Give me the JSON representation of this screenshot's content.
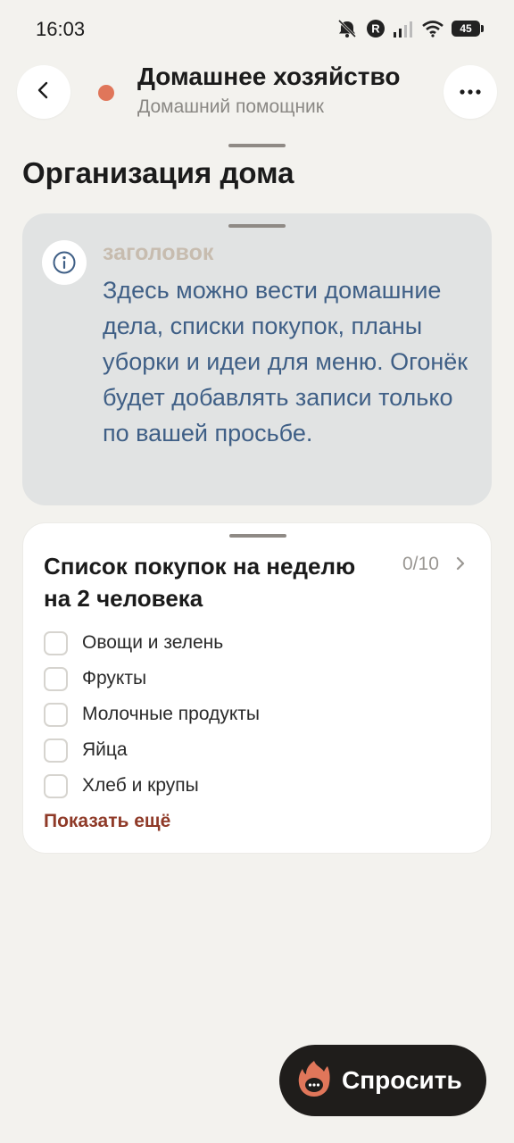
{
  "status_bar": {
    "time": "16:03",
    "battery": "45",
    "icons": [
      "mute-icon",
      "r-badge-icon",
      "signal-icon",
      "wifi-icon",
      "battery-icon"
    ]
  },
  "header": {
    "title": "Домашнее хозяйство",
    "subtitle": "Домашний помощник",
    "back_icon": "chevron-left-icon",
    "menu_icon": "more-horizontal-icon",
    "dot_color": "#e0765a"
  },
  "section": {
    "title": "Организация дома"
  },
  "info_card": {
    "label": "заголовок",
    "text": "Здесь можно вести домашние дела, списки покупок, планы уборки и идеи для меню. Огонёк будет добавлять записи только по вашей просьбе.",
    "icon": "info-icon"
  },
  "list_card": {
    "title": "Список покупок на неделю на 2 человека",
    "count": "0/10",
    "items": [
      {
        "label": "Овощи и зелень",
        "checked": false
      },
      {
        "label": "Фрукты",
        "checked": false
      },
      {
        "label": "Молочные продукты",
        "checked": false
      },
      {
        "label": "Яйца",
        "checked": false
      },
      {
        "label": "Хлеб и крупы",
        "checked": false
      }
    ],
    "show_more": "Показать ещё",
    "show_more_color": "#8f3a28"
  },
  "ask_button": {
    "label": "Спросить",
    "icon": "flame-chat-icon",
    "accent": "#e0765a"
  }
}
